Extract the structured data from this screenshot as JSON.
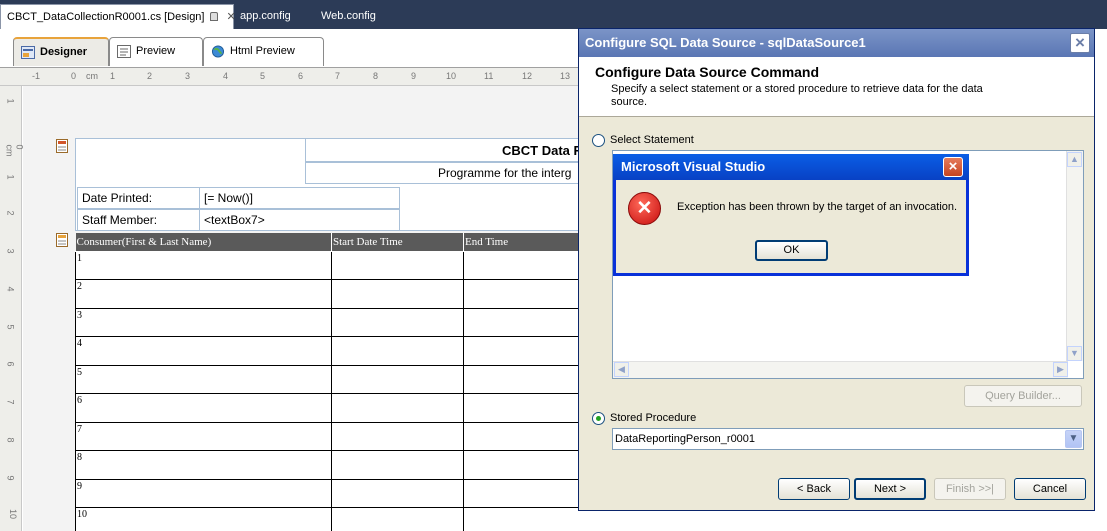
{
  "doc_tabs": [
    {
      "label": "CBCT_DataCollectionR0001.cs [Design]"
    },
    {
      "label": "app.config"
    },
    {
      "label": "Web.config"
    }
  ],
  "designer_tabs": [
    {
      "label": "Designer"
    },
    {
      "label": "Preview"
    },
    {
      "label": "Html Preview"
    }
  ],
  "ruler": {
    "top": [
      "-1",
      "0",
      "cm",
      "1",
      "2",
      "3",
      "4",
      "5",
      "6",
      "7",
      "8",
      "9",
      "10",
      "11",
      "12",
      "13"
    ],
    "left": [
      "1",
      "0 cm",
      "1",
      "2",
      "3",
      "4",
      "5",
      "6",
      "7",
      "8",
      "9",
      "10"
    ]
  },
  "report": {
    "title": "CBCT Data F",
    "subtitle": "Programme for the interg",
    "fields": [
      {
        "label": "Date Printed:",
        "value": "[= Now()]"
      },
      {
        "label": "Staff Member:",
        "value": "<textBox7>"
      }
    ],
    "columns": [
      "Consumer(First & Last Name)",
      "Start Date Time",
      "End Time",
      "",
      "",
      ""
    ],
    "rows": [
      "1",
      "2",
      "3",
      "4",
      "5",
      "6",
      "7",
      "8",
      "9",
      "10"
    ]
  },
  "dialog": {
    "title": "Configure SQL Data Source - sqlDataSource1",
    "heading": "Configure Data Source Command",
    "description": "Specify a select statement or a stored procedure to retrieve data for the data source.",
    "select_label": "Select Statement",
    "query_builder": "Query Builder...",
    "stored_label": "Stored Procedure",
    "stored_value": "DataReportingPerson_r0001",
    "back": "< Back",
    "next": "Next >",
    "finish": "Finish >>|",
    "cancel": "Cancel"
  },
  "message_box": {
    "title": "Microsoft Visual Studio",
    "text": "Exception has been thrown by the target of an invocation.",
    "ok": "OK"
  },
  "colors": {
    "tab_strip": "#2c3b57",
    "dialog_title": "#5a76b4",
    "msg_title": "#0a5ee6",
    "table_header": "#5a5a5a"
  }
}
